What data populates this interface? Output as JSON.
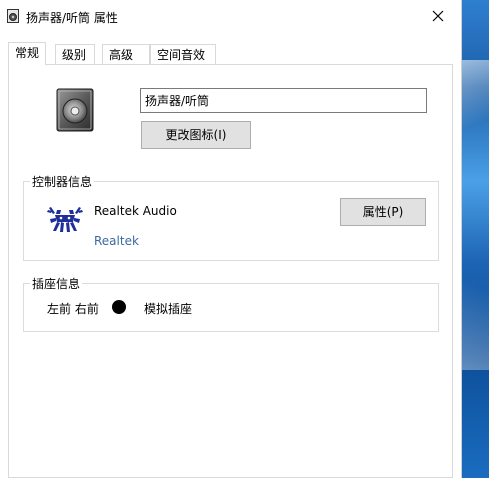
{
  "window": {
    "title": "扬声器/听筒 属性"
  },
  "tabs": [
    {
      "label": "常规",
      "active": true
    },
    {
      "label": "级别",
      "active": false
    },
    {
      "label": "高级",
      "active": false
    },
    {
      "label": "空间音效",
      "active": false
    }
  ],
  "general": {
    "device_name_value": "扬声器/听筒",
    "change_icon_label": "更改图标(I)",
    "controller_group_label": "控制器信息",
    "controller_name": "Realtek Audio",
    "controller_vendor": "Realtek",
    "properties_label": "属性(P)",
    "jack_group_label": "插座信息",
    "jack_position": "左前 右前",
    "jack_type": "模拟插座",
    "jack_color": "#000000"
  },
  "icons": {
    "title": "speaker-icon",
    "close": "close-icon",
    "device": "speaker-icon",
    "vendor": "realtek-crab-icon"
  }
}
